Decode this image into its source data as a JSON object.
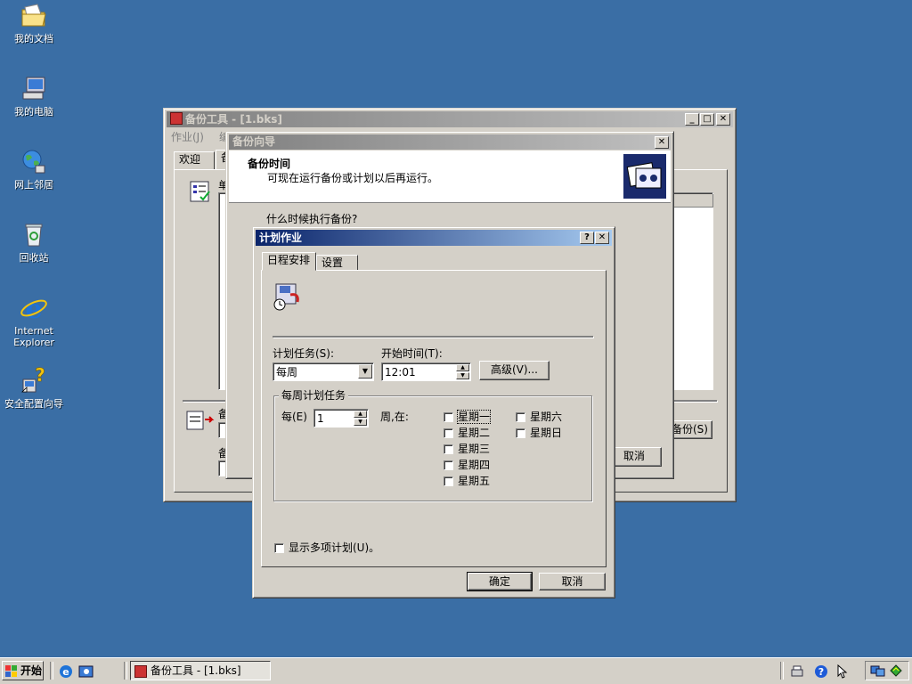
{
  "desktop": {
    "icons": [
      {
        "label": "我的文档"
      },
      {
        "label": "我的电脑"
      },
      {
        "label": "网上邻居"
      },
      {
        "label": "回收站"
      },
      {
        "label": "Internet\nExplorer"
      },
      {
        "label": "安全配置向导"
      }
    ]
  },
  "backup_window": {
    "title": "备份工具 - [1.bks]",
    "menu": [
      "作业(J)",
      "编辑"
    ],
    "tabs": [
      "欢迎",
      "备"
    ],
    "partial_labels": [
      "单",
      "备",
      "备"
    ],
    "side_button": "备份(S)"
  },
  "wizard": {
    "title": "备份向导",
    "header_title": "备份时间",
    "header_subtitle": "可现在运行备份或计划以后再运行。",
    "question": "什么时候执行备份?",
    "cancel": "取消"
  },
  "schedule": {
    "title": "计划作业",
    "help_btn": "?",
    "close_btn": "✕",
    "tabs": [
      "日程安排",
      "设置"
    ],
    "task_label": "计划任务(S):",
    "task_value": "每周",
    "start_label": "开始时间(T):",
    "start_value": "12:01",
    "advanced_btn": "高级(V)...",
    "weekly_group": "每周计划任务",
    "every_label": "每(E)",
    "every_value": "1",
    "week_on_label": "周,在:",
    "days": [
      {
        "label": "星期一",
        "checked": false
      },
      {
        "label": "星期二",
        "checked": false
      },
      {
        "label": "星期三",
        "checked": false
      },
      {
        "label": "星期四",
        "checked": false
      },
      {
        "label": "星期五",
        "checked": false
      },
      {
        "label": "星期六",
        "checked": false
      },
      {
        "label": "星期日",
        "checked": false
      }
    ],
    "show_multiple": "显示多项计划(U)。",
    "ok_btn": "确定",
    "cancel_btn": "取消"
  },
  "taskbar": {
    "start": "开始",
    "task_item": "备份工具 - [1.bks]"
  },
  "colors": {
    "desktop": "#3a6ea5",
    "active_title": "#0a246a",
    "face": "#d4d0c8"
  }
}
